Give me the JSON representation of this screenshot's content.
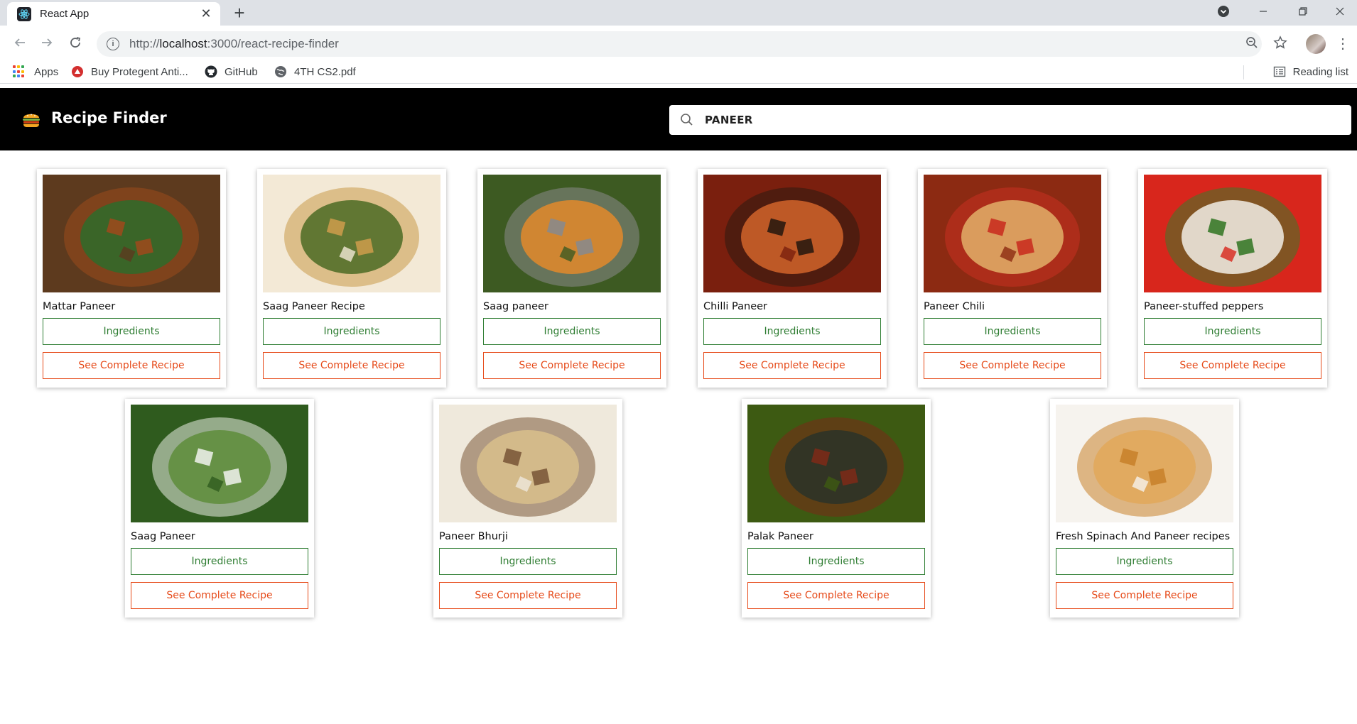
{
  "browser": {
    "tab_title": "React App",
    "new_tab_symbol": "+",
    "url_scheme": "http://",
    "url_host": "localhost",
    "url_rest": ":3000/react-recipe-finder"
  },
  "bookmarks": [
    {
      "label": "Apps",
      "icon": "apps-grid-icon"
    },
    {
      "label": "Buy Protegent Anti...",
      "icon": "protegent-icon"
    },
    {
      "label": "GitHub",
      "icon": "github-icon"
    },
    {
      "label": "4TH CS2.pdf",
      "icon": "globe-icon"
    }
  ],
  "reading_list": "Reading list",
  "app": {
    "brand": "Recipe Finder",
    "search_value": "PANEER"
  },
  "actions": {
    "ingredients": "Ingredients",
    "see_recipe": "See Complete Recipe"
  },
  "recipes": [
    {
      "title": "Mattar Paneer",
      "palette": [
        "#5d3a1e",
        "#2e6b2a",
        "#9a4a1c"
      ]
    },
    {
      "title": "Saag Paneer Recipe",
      "palette": [
        "#f3e9d6",
        "#4b6b24",
        "#c99a4a"
      ]
    },
    {
      "title": "Saag paneer",
      "palette": [
        "#3d5a22",
        "#e38a2c",
        "#8a8a8a"
      ]
    },
    {
      "title": "Chilli Paneer",
      "palette": [
        "#7a1f0e",
        "#d1642a",
        "#2b1a10"
      ]
    },
    {
      "title": "Paneer Chili",
      "palette": [
        "#8c2a12",
        "#e2b06a",
        "#c93020"
      ]
    },
    {
      "title": "Paneer-stuffed peppers",
      "palette": [
        "#d8261c",
        "#f2efe6",
        "#3a7a2a"
      ]
    },
    {
      "title": "Saag Paneer",
      "palette": [
        "#2f5b1e",
        "#5e8c3a",
        "#e9ede4"
      ]
    },
    {
      "title": "Paneer Bhurji",
      "palette": [
        "#efe9dc",
        "#d9c08c",
        "#7c5a3a"
      ]
    },
    {
      "title": "Palak Paneer",
      "palette": [
        "#3d5a12",
        "#2a3328",
        "#7a2a18"
      ]
    },
    {
      "title": "Fresh Spinach And Paneer recipes",
      "palette": [
        "#f6f3ee",
        "#e2a85a",
        "#c9822c"
      ]
    }
  ]
}
